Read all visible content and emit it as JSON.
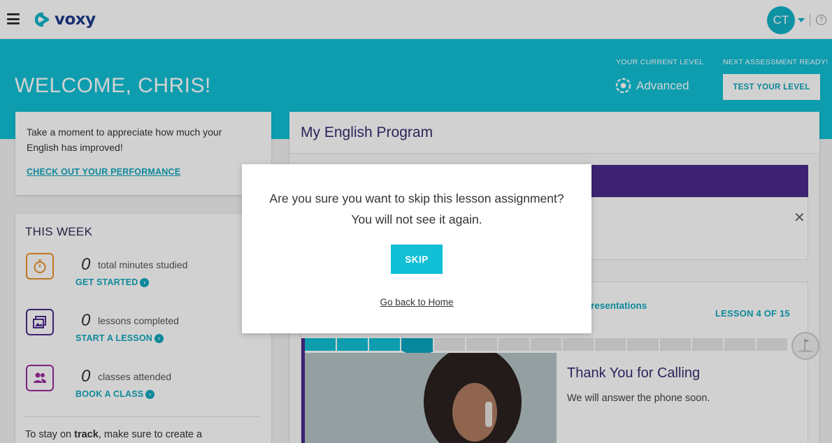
{
  "header": {
    "logo_text": "voxy",
    "avatar_initials": "CT",
    "help_glyph": "?"
  },
  "hero": {
    "welcome": "WELCOME, CHRIS!",
    "level_label": "YOUR CURRENT LEVEL",
    "level_value": "Advanced",
    "assessment_label": "NEXT ASSESSMENT READY!",
    "test_button": "TEST YOUR LEVEL"
  },
  "improve_card": {
    "text": "Take a moment to appreciate how much your English has improved!",
    "link": "CHECK OUT YOUR PERFORMANCE"
  },
  "this_week": {
    "title": "THIS WEEK",
    "stats": [
      {
        "value": "0",
        "label": "total minutes studied",
        "link": "GET STARTED",
        "icon": "stopwatch-icon",
        "color": "#e8942a"
      },
      {
        "value": "0",
        "label": "lessons completed",
        "link": "START A LESSON",
        "icon": "images-icon",
        "color": "#4b2a8c"
      },
      {
        "value": "0",
        "label": "classes attended",
        "link": "BOOK A CLASS",
        "icon": "people-icon",
        "color": "#9b2a9c"
      }
    ],
    "track_prefix": "To stay on ",
    "track_bold": "track",
    "track_suffix": ", make sure to create a"
  },
  "program": {
    "title": "My English Program",
    "close_glyph": "✕",
    "lesson_topic": "resentations",
    "lesson_count": "LESSON 4 OF 15",
    "lesson_title": "Thank You for Calling",
    "lesson_desc": "We will answer the phone soon.",
    "progress_total": 15,
    "progress_current": 4
  },
  "modal": {
    "question_line1": "Are you sure you want to skip this lesson assignment?",
    "question_line2": "You will not see it again.",
    "skip_button": "SKIP",
    "back_link": "Go back to Home"
  },
  "colors": {
    "accent": "#11c0d6",
    "link": "#11a8be",
    "purple": "#4b2a8c"
  }
}
